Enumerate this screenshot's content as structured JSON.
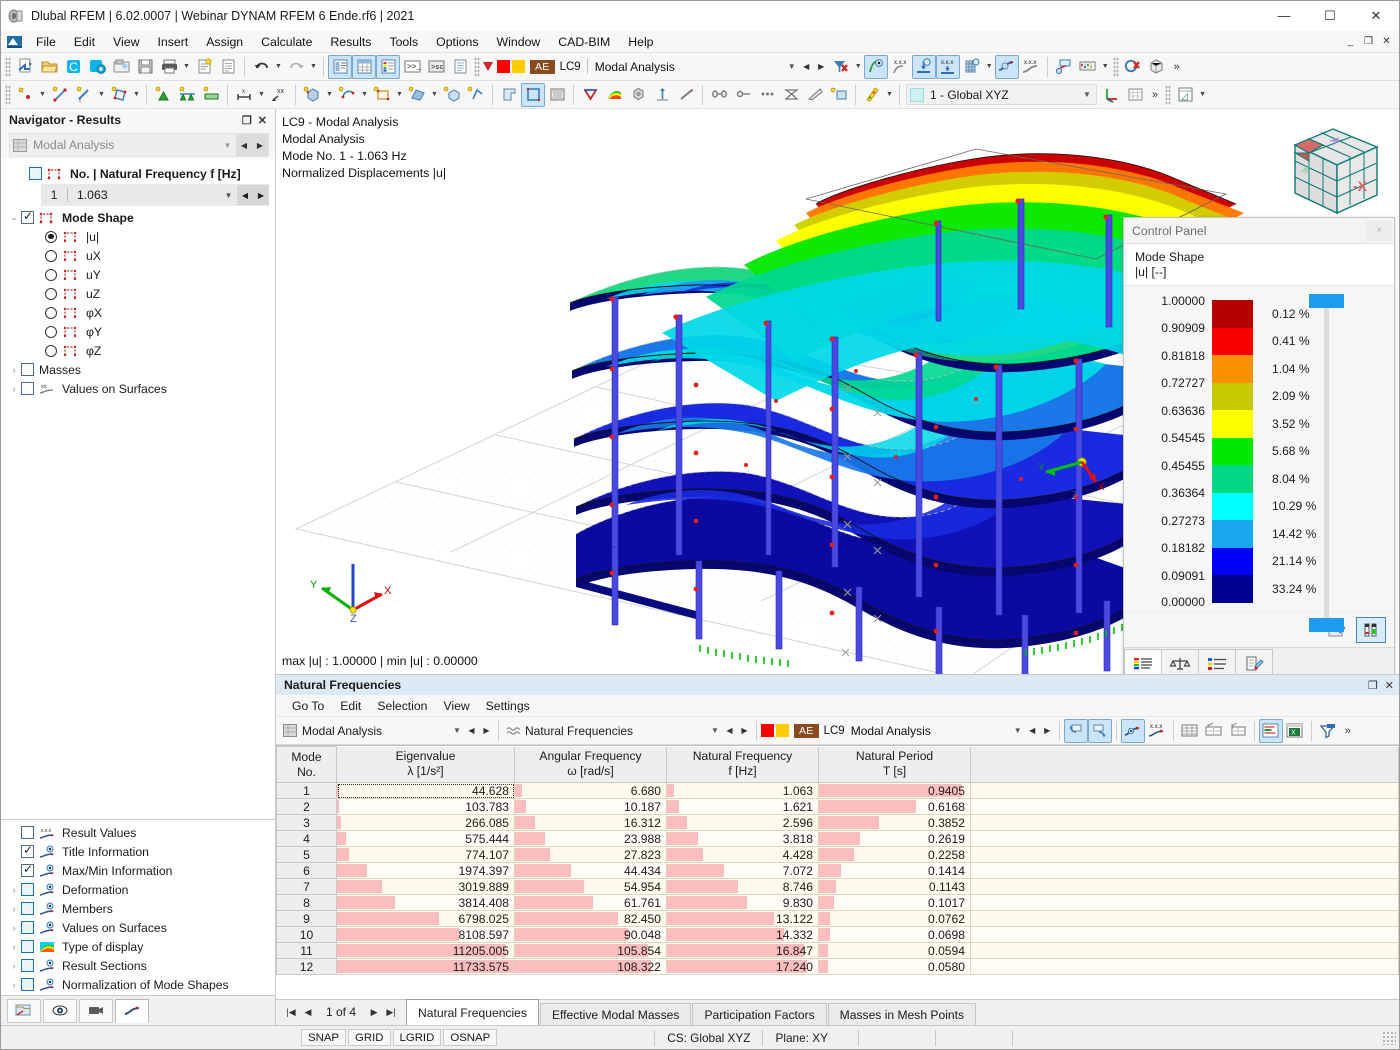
{
  "window": {
    "title": "Dlubal RFEM | 6.02.0007 | Webinar DYNAM RFEM 6 Ende.rf6 | 2021",
    "minimize": "—",
    "maximize": "☐",
    "close": "✕",
    "doc_minimize": "_",
    "doc_restore": "❐",
    "doc_close": "✕"
  },
  "menubar": [
    "File",
    "Edit",
    "View",
    "Insert",
    "Assign",
    "Calculate",
    "Results",
    "Tools",
    "Options",
    "Window",
    "CAD-BIM",
    "Help"
  ],
  "toolbar_loadcase": {
    "swatch1": "#ff0000",
    "swatch2": "#ffcc00",
    "badge": "AE",
    "case_id": "LC9",
    "case_name": "Modal Analysis"
  },
  "toolbar_cs": {
    "label": "1 - Global XYZ"
  },
  "navigator": {
    "title": "Navigator - Results",
    "undock": "❐",
    "close": "✕",
    "combo": "Modal Analysis",
    "tree": {
      "freq_group": "No. | Natural Frequency f [Hz]",
      "freq_no": "1",
      "freq_value": "1.063",
      "mode_shape": "Mode Shape",
      "components": [
        "|u|",
        "uX",
        "uY",
        "uZ",
        "φX",
        "φY",
        "φZ"
      ],
      "selected_component": "|u|",
      "masses": "Masses",
      "values_on_surfaces": "Values on Surfaces"
    },
    "display_items": [
      {
        "label": "Result Values",
        "checked": false,
        "expandable": false,
        "icon": "result-values-icon"
      },
      {
        "label": "Title Information",
        "checked": true,
        "expandable": false,
        "icon": "title-info-icon"
      },
      {
        "label": "Max/Min Information",
        "checked": true,
        "expandable": false,
        "icon": "maxmin-icon"
      },
      {
        "label": "Deformation",
        "checked": false,
        "expandable": true,
        "icon": "deformation-icon"
      },
      {
        "label": "Members",
        "checked": false,
        "expandable": true,
        "icon": "members-icon"
      },
      {
        "label": "Values on Surfaces",
        "checked": false,
        "expandable": true,
        "icon": "surfaces-icon"
      },
      {
        "label": "Type of display",
        "checked": false,
        "expandable": true,
        "icon": "display-type-icon"
      },
      {
        "label": "Result Sections",
        "checked": false,
        "expandable": true,
        "icon": "sections-icon"
      },
      {
        "label": "Normalization of Mode Shapes",
        "checked": false,
        "expandable": true,
        "icon": "normalization-icon"
      }
    ]
  },
  "viewport": {
    "title_lines": "LC9 - Modal Analysis\nModal Analysis\nMode No. 1 - 1.063 Hz\nNormalized Displacements |u|",
    "minmax": "max |u| : 1.00000 | min |u| : 0.00000",
    "navcube_face": "-X",
    "axis_x": "X",
    "axis_y": "Y",
    "axis_z": "Z"
  },
  "control_panel": {
    "title": "Control Panel",
    "close": "×",
    "subtitle_line1": "Mode Shape",
    "subtitle_line2": "|u| [--]",
    "scale_values": [
      "1.00000",
      "0.90909",
      "0.81818",
      "0.72727",
      "0.63636",
      "0.54545",
      "0.45455",
      "0.36364",
      "0.27273",
      "0.18182",
      "0.09091",
      "0.00000"
    ],
    "bands": [
      {
        "color": "#b40000",
        "percent": "0.12 %"
      },
      {
        "color": "#f80000",
        "percent": "0.41 %"
      },
      {
        "color": "#f89000",
        "percent": "1.04 %"
      },
      {
        "color": "#c8c800",
        "percent": "2.09 %"
      },
      {
        "color": "#ffff00",
        "percent": "3.52 %"
      },
      {
        "color": "#00e800",
        "percent": "5.68 %"
      },
      {
        "color": "#00d884",
        "percent": "8.04 %"
      },
      {
        "color": "#00ffff",
        "percent": "10.29 %"
      },
      {
        "color": "#18a8f0",
        "percent": "14.42 %"
      },
      {
        "color": "#0000f8",
        "percent": "21.14 %"
      },
      {
        "color": "#000090",
        "percent": "33.24 %"
      }
    ]
  },
  "table_panel": {
    "title": "Natural Frequencies",
    "undock": "❐",
    "close": "✕",
    "menu": [
      "Go To",
      "Edit",
      "Selection",
      "View",
      "Settings"
    ],
    "combo_left": "Modal Analysis",
    "combo_right": "Natural Frequencies",
    "loadcase": {
      "swatch1": "#ff0000",
      "swatch2": "#ffcc00",
      "badge": "AE",
      "case_id": "LC9",
      "case_name": "Modal Analysis"
    },
    "columns": [
      {
        "title": "Mode",
        "sub": "No."
      },
      {
        "title": "Eigenvalue",
        "sub": "λ [1/s²]"
      },
      {
        "title": "Angular Frequency",
        "sub": "ω [rad/s]"
      },
      {
        "title": "Natural Frequency",
        "sub": "f [Hz]"
      },
      {
        "title": "Natural Period",
        "sub": "T [s]"
      },
      {
        "title": "",
        "sub": ""
      }
    ],
    "rows": [
      {
        "no": "1",
        "eigenvalue": "44.628",
        "ev_bar": 0.4,
        "omega": "6.680",
        "om_bar": 4.5,
        "freq": "1.063",
        "f_bar": 4.8,
        "period": "0.9405",
        "t_bar": 95.0
      },
      {
        "no": "2",
        "eigenvalue": "103.783",
        "ev_bar": 0.9,
        "omega": "10.187",
        "om_bar": 7.5,
        "freq": "1.621",
        "f_bar": 7.7,
        "period": "0.6168",
        "t_bar": 64.0
      },
      {
        "no": "3",
        "eigenvalue": "266.085",
        "ev_bar": 2.3,
        "omega": "16.312",
        "om_bar": 13.0,
        "freq": "2.596",
        "f_bar": 13.1,
        "period": "0.3852",
        "t_bar": 40.0
      },
      {
        "no": "4",
        "eigenvalue": "575.444",
        "ev_bar": 4.9,
        "omega": "23.988",
        "om_bar": 19.8,
        "freq": "3.818",
        "f_bar": 20.5,
        "period": "0.2619",
        "t_bar": 27.0
      },
      {
        "no": "5",
        "eigenvalue": "774.107",
        "ev_bar": 6.6,
        "omega": "27.823",
        "om_bar": 23.0,
        "freq": "4.428",
        "f_bar": 23.8,
        "period": "0.2258",
        "t_bar": 23.5
      },
      {
        "no": "6",
        "eigenvalue": "1974.397",
        "ev_bar": 16.8,
        "omega": "44.434",
        "om_bar": 37.0,
        "freq": "7.072",
        "f_bar": 38.0,
        "period": "0.1414",
        "t_bar": 14.5
      },
      {
        "no": "7",
        "eigenvalue": "3019.889",
        "ev_bar": 25.7,
        "omega": "54.954",
        "om_bar": 45.7,
        "freq": "8.746",
        "f_bar": 47.0,
        "period": "0.1143",
        "t_bar": 11.5
      },
      {
        "no": "8",
        "eigenvalue": "3814.408",
        "ev_bar": 32.5,
        "omega": "61.761",
        "om_bar": 51.5,
        "freq": "9.830",
        "f_bar": 53.0,
        "period": "0.1017",
        "t_bar": 10.0
      },
      {
        "no": "9",
        "eigenvalue": "6798.025",
        "ev_bar": 57.9,
        "omega": "82.450",
        "om_bar": 68.5,
        "freq": "13.122",
        "f_bar": 71.0,
        "period": "0.0762",
        "t_bar": 7.5
      },
      {
        "no": "10",
        "eigenvalue": "8108.597",
        "ev_bar": 69.1,
        "omega": "90.048",
        "om_bar": 75.0,
        "freq": "14.332",
        "f_bar": 77.5,
        "period": "0.0698",
        "t_bar": 7.0
      },
      {
        "no": "11",
        "eigenvalue": "11205.005",
        "ev_bar": 95.5,
        "omega": "105.854",
        "om_bar": 88.0,
        "freq": "16.847",
        "f_bar": 91.0,
        "period": "0.0594",
        "t_bar": 6.0
      },
      {
        "no": "12",
        "eigenvalue": "11733.575",
        "ev_bar": 100.0,
        "omega": "108.322",
        "om_bar": 90.0,
        "freq": "17.240",
        "f_bar": 93.0,
        "period": "0.0580",
        "t_bar": 5.8
      }
    ],
    "pager": {
      "first": "|◀",
      "prev": "◀",
      "text": "1 of 4",
      "next": "▶",
      "last": "▶|"
    },
    "tabs": [
      "Natural Frequencies",
      "Effective Modal Masses",
      "Participation Factors",
      "Masses in Mesh Points"
    ],
    "selected_tab": "Natural Frequencies"
  },
  "statusbar": {
    "toggles": [
      "SNAP",
      "GRID",
      "LGRID",
      "OSNAP"
    ],
    "cs": "CS: Global XYZ",
    "plane": "Plane: XY"
  },
  "chart_data": {
    "type": "table",
    "title": "Natural Frequencies",
    "columns": [
      "Mode No.",
      "Eigenvalue λ [1/s²]",
      "Angular Frequency ω [rad/s]",
      "Natural Frequency f [Hz]",
      "Natural Period T [s]"
    ],
    "rows": [
      [
        1,
        44.628,
        6.68,
        1.063,
        0.9405
      ],
      [
        2,
        103.783,
        10.187,
        1.621,
        0.6168
      ],
      [
        3,
        266.085,
        16.312,
        2.596,
        0.3852
      ],
      [
        4,
        575.444,
        23.988,
        3.818,
        0.2619
      ],
      [
        5,
        774.107,
        27.823,
        4.428,
        0.2258
      ],
      [
        6,
        1974.397,
        44.434,
        7.072,
        0.1414
      ],
      [
        7,
        3019.889,
        54.954,
        8.746,
        0.1143
      ],
      [
        8,
        3814.408,
        61.761,
        9.83,
        0.1017
      ],
      [
        9,
        6798.025,
        82.45,
        13.122,
        0.0762
      ],
      [
        10,
        8108.597,
        90.048,
        14.332,
        0.0698
      ],
      [
        11,
        11205.005,
        105.854,
        16.847,
        0.0594
      ],
      [
        12,
        11733.575,
        108.322,
        17.24,
        0.058
      ]
    ]
  }
}
